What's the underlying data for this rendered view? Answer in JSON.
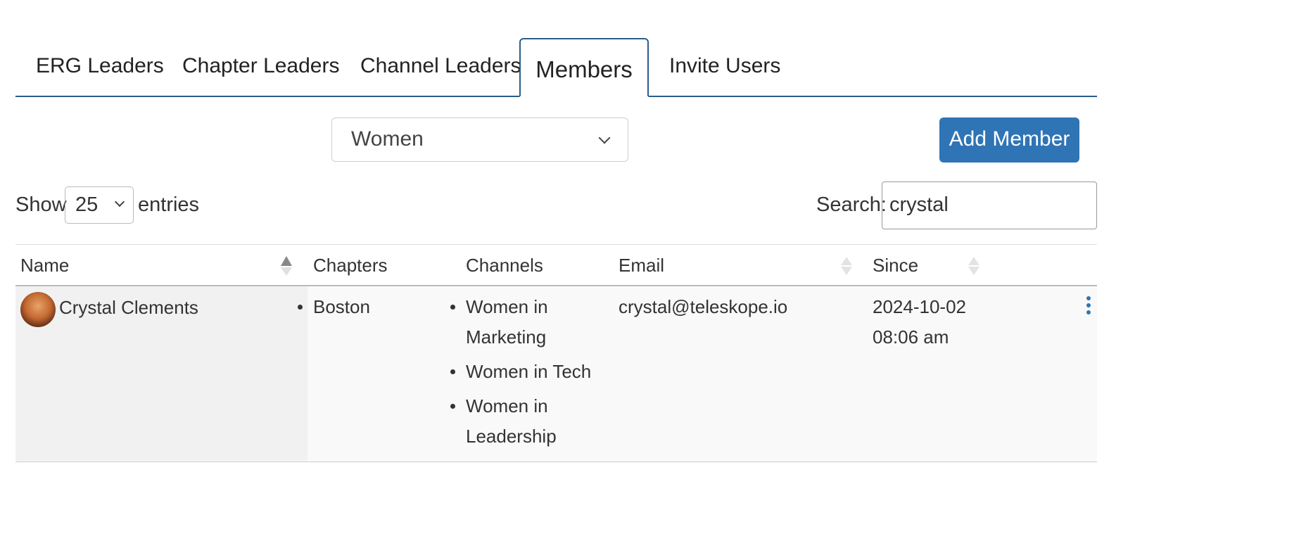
{
  "tabs": [
    {
      "label": "ERG Leaders"
    },
    {
      "label": "Chapter Leaders"
    },
    {
      "label": "Channel Leaders"
    },
    {
      "label": "Members",
      "active": true
    },
    {
      "label": "Invite Users"
    }
  ],
  "group_select": {
    "value": "Women"
  },
  "add_member": {
    "label": "Add Member"
  },
  "length": {
    "show": "Show",
    "value": "25",
    "entries": "entries"
  },
  "search": {
    "label": "Search:",
    "value": "crystal"
  },
  "columns": {
    "name": "Name",
    "chapters": "Chapters",
    "channels": "Channels",
    "email": "Email",
    "since": "Since"
  },
  "rows": [
    {
      "name": "Crystal Clements",
      "chapters": [
        "Boston"
      ],
      "channels": [
        "Women in Marketing",
        "Women in Tech",
        "Women in Leadership"
      ],
      "email": "crystal@teleskope.io",
      "since_date": "2024-10-02",
      "since_time": "08:06 am"
    }
  ],
  "colors": {
    "accent": "#2f74b5",
    "tab_border": "#2a5d8c"
  }
}
